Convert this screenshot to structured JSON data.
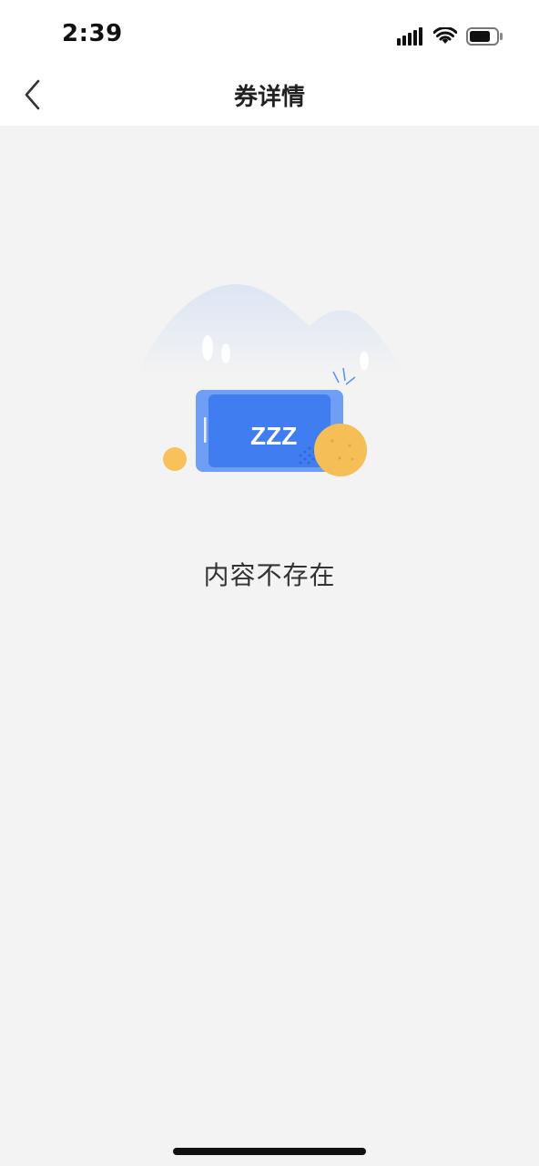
{
  "status_bar": {
    "time": "2:39",
    "icons": [
      "signal-icon",
      "wifi-icon",
      "battery-icon"
    ]
  },
  "nav": {
    "back_icon": "chevron-left-icon",
    "title": "券详情"
  },
  "empty_state": {
    "illustration_icon": "sleeping-phone-icon",
    "illustration_text": "ZZZ",
    "message": "内容不存在"
  },
  "colors": {
    "background": "#f3f3f3",
    "header": "#ffffff",
    "accent_blue": "#3f7df0",
    "coin_yellow": "#f7c25c"
  }
}
